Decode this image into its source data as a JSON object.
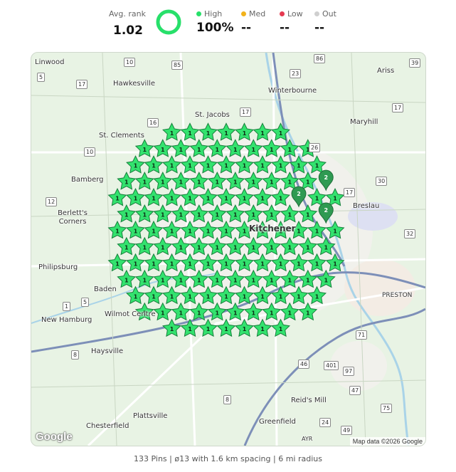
{
  "summary": {
    "avg_rank_label": "Avg. rank",
    "avg_rank_value": "1.02",
    "ring_fraction": 1.0,
    "ring_color": "#27e06a",
    "legend": [
      {
        "key": "high",
        "label": "High",
        "value": "100%",
        "color": "#27e06a"
      },
      {
        "key": "med",
        "label": "Med",
        "value": "--",
        "color": "#f2b21b"
      },
      {
        "key": "low",
        "label": "Low",
        "value": "--",
        "color": "#e53950"
      },
      {
        "key": "out",
        "label": "Out",
        "value": "--",
        "color": "#cfcfcf"
      }
    ]
  },
  "map": {
    "places": [
      "Linwood",
      "Hawkesville",
      "Winterbourne",
      "Ariss",
      "St. Jacobs",
      "St. Clements",
      "Maryhill",
      "Bamberg",
      "Breslau",
      "Berlett's Corners",
      "Philipsburg",
      "Kitchener",
      "Baden",
      "New Hamburg",
      "Wilmot Centre",
      "Haysville",
      "PRESTON",
      "Reid's Mill",
      "Plattsville",
      "Chesterfield",
      "Greenfield",
      "AYR"
    ],
    "route_shields": [
      "5",
      "10",
      "85",
      "86",
      "39",
      "17",
      "23",
      "16",
      "17",
      "17",
      "10",
      "26",
      "12",
      "17",
      "30",
      "32",
      "71",
      "1",
      "5",
      "8",
      "46",
      "401",
      "97",
      "47",
      "75",
      "8",
      "49",
      "24"
    ],
    "google_logo": "Google",
    "attribution": "Map data ©2026 Google",
    "pin_color": "#33e26e",
    "pin_rank_common": "1",
    "cluster_color": "#2f9a52",
    "cluster_rank": "2",
    "cluster_pins": 3
  },
  "footer": {
    "text": "133 Pins | ø13 with 1.6 km spacing | 6 mi radius"
  }
}
